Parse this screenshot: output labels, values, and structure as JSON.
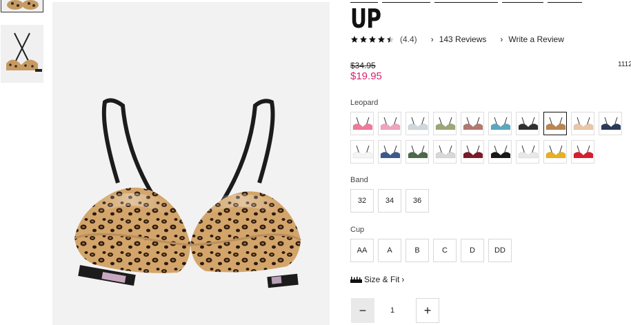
{
  "product": {
    "title_line": "UP",
    "rating_value": "(4.4)",
    "stars_filled": 4.4,
    "reviews_link": "143 Reviews",
    "write_review_link": "Write a Review",
    "original_price": "$34.95",
    "sale_price": "$19.95",
    "item_number_fragment": "1112"
  },
  "colors": {
    "sale": "#d6246e",
    "selected_label": "Leopard",
    "swatch_colors": [
      [
        "#f07a9a",
        "#f0a4c0",
        "#cfd8dc",
        "#9aa878",
        "#b07a70",
        "#5aa8c0",
        "#303030",
        "#b98550",
        "#e8c8a8",
        "#2a3a5a"
      ],
      [
        "#f5f5f5",
        "#3a5a8a",
        "#4a6a4a",
        "#d8d8d8",
        "#7a1a2a",
        "#181818",
        "#e8e8e8",
        "#e8b020",
        "#d81e2e"
      ]
    ]
  },
  "band": {
    "label": "Band",
    "options": [
      "32",
      "34",
      "36"
    ]
  },
  "cup": {
    "label": "Cup",
    "options": [
      "AA",
      "A",
      "B",
      "C",
      "D",
      "DD"
    ]
  },
  "size_fit": {
    "label": "Size & Fit"
  },
  "quantity": {
    "value": "1"
  }
}
